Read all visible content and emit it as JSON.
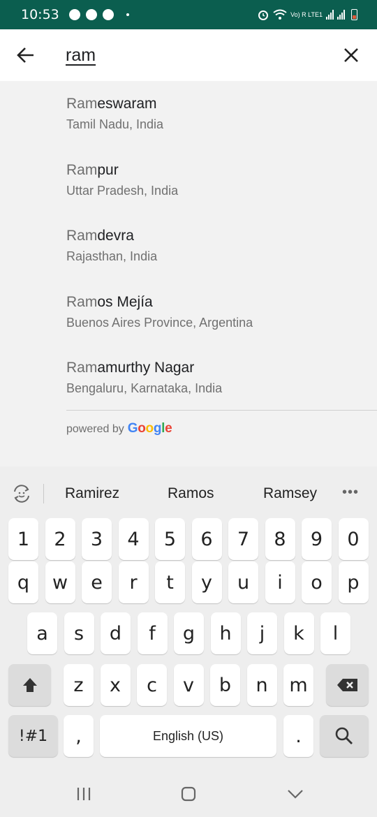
{
  "status_bar": {
    "time": "10:53",
    "left_icons": [
      "notification-icon",
      "notification-icon",
      "message-icon"
    ],
    "network_label": "Vo) R LTE1"
  },
  "search": {
    "query": "ram",
    "back_icon": "arrow-left-icon",
    "clear_icon": "close-icon"
  },
  "results": [
    {
      "match": "Ram",
      "rest": "eswaram",
      "region": "Tamil Nadu, India"
    },
    {
      "match": "Ram",
      "rest": "pur",
      "region": "Uttar Pradesh, India"
    },
    {
      "match": "Ram",
      "rest": "devra",
      "region": "Rajasthan, India"
    },
    {
      "match": "Ram",
      "rest": "os Mejía",
      "region": "Buenos Aires Province, Argentina"
    },
    {
      "match": "Ram",
      "rest": "amurthy Nagar",
      "region": "Bengaluru, Karnataka, India"
    }
  ],
  "attribution": {
    "prefix": "powered by",
    "brand": [
      "G",
      "o",
      "o",
      "g",
      "l",
      "e"
    ],
    "brand_colors": [
      "#4285F4",
      "#EA4335",
      "#FBBC05",
      "#4285F4",
      "#34A853",
      "#EA4335"
    ]
  },
  "keyboard": {
    "suggestions": [
      "Ramirez",
      "Ramos",
      "Ramsey"
    ],
    "more_label": "•••",
    "row_numbers": [
      "1",
      "2",
      "3",
      "4",
      "5",
      "6",
      "7",
      "8",
      "9",
      "0"
    ],
    "row_top": [
      "q",
      "w",
      "e",
      "r",
      "t",
      "y",
      "u",
      "i",
      "o",
      "p"
    ],
    "row_home": [
      "a",
      "s",
      "d",
      "f",
      "g",
      "h",
      "j",
      "k",
      "l"
    ],
    "row_bottom": [
      "z",
      "x",
      "c",
      "v",
      "b",
      "n",
      "m"
    ],
    "symbols_label": "!#1",
    "comma_label": ",",
    "space_label": "English (US)",
    "period_label": "."
  },
  "colors": {
    "status_bar": "#0b5e4f"
  }
}
